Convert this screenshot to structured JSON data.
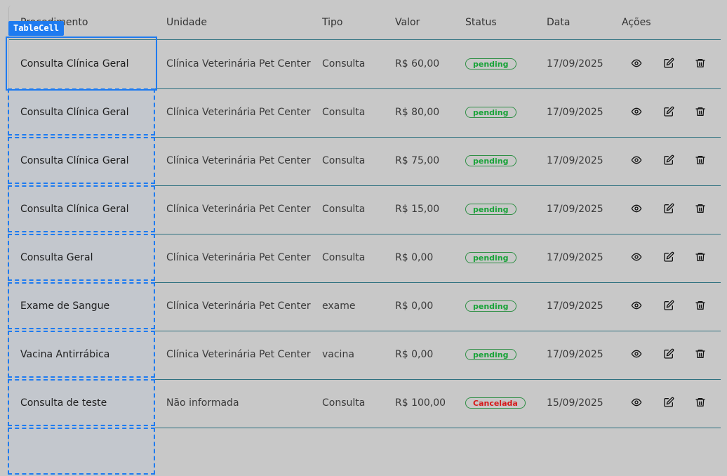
{
  "overlay": {
    "tag_label": "TableCell"
  },
  "table": {
    "headers": {
      "procedimento": "Procedimento",
      "unidade": "Unidade",
      "tipo": "Tipo",
      "valor": "Valor",
      "status": "Status",
      "data": "Data",
      "acoes": "Ações"
    },
    "rows": [
      {
        "procedimento": "Consulta Clínica Geral",
        "unidade": "Clínica Veterinária Pet Center",
        "tipo": "Consulta",
        "valor": "R$ 60,00",
        "status": "pending",
        "status_kind": "pending",
        "data": "17/09/2025"
      },
      {
        "procedimento": "Consulta Clínica Geral",
        "unidade": "Clínica Veterinária Pet Center",
        "tipo": "Consulta",
        "valor": "R$ 80,00",
        "status": "pending",
        "status_kind": "pending",
        "data": "17/09/2025"
      },
      {
        "procedimento": "Consulta Clínica Geral",
        "unidade": "Clínica Veterinária Pet Center",
        "tipo": "Consulta",
        "valor": "R$ 75,00",
        "status": "pending",
        "status_kind": "pending",
        "data": "17/09/2025"
      },
      {
        "procedimento": "Consulta Clínica Geral",
        "unidade": "Clínica Veterinária Pet Center",
        "tipo": "Consulta",
        "valor": "R$ 15,00",
        "status": "pending",
        "status_kind": "pending",
        "data": "17/09/2025"
      },
      {
        "procedimento": "Consulta Geral",
        "unidade": "Clínica Veterinária Pet Center",
        "tipo": "Consulta",
        "valor": "R$ 0,00",
        "status": "pending",
        "status_kind": "pending",
        "data": "17/09/2025"
      },
      {
        "procedimento": "Exame de Sangue",
        "unidade": "Clínica Veterinária Pet Center",
        "tipo": "exame",
        "valor": "R$ 0,00",
        "status": "pending",
        "status_kind": "pending",
        "data": "17/09/2025"
      },
      {
        "procedimento": "Vacina Antirrábica",
        "unidade": "Clínica Veterinária Pet Center",
        "tipo": "vacina",
        "valor": "R$ 0,00",
        "status": "pending",
        "status_kind": "pending",
        "data": "17/09/2025"
      },
      {
        "procedimento": "Consulta de teste",
        "unidade": "Não informada",
        "tipo": "Consulta",
        "valor": "R$ 100,00",
        "status": "Cancelada",
        "status_kind": "cancel",
        "data": "15/09/2025"
      }
    ]
  },
  "icons": {
    "view": "eye-icon",
    "edit": "edit-icon",
    "delete": "trash-icon"
  },
  "colors": {
    "row_border": "#2e7180",
    "selection": "#1e7bf0",
    "pending": "#18a338",
    "cancel": "#d61a1a"
  }
}
